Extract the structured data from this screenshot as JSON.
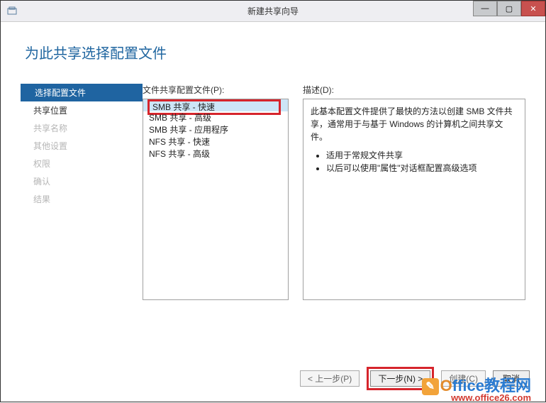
{
  "titlebar": {
    "title": "新建共享向导"
  },
  "heading": "为此共享选择配置文件",
  "sidebar": {
    "items": [
      {
        "label": "选择配置文件",
        "active": true,
        "enabled": true
      },
      {
        "label": "共享位置",
        "active": false,
        "enabled": true
      },
      {
        "label": "共享名称",
        "active": false,
        "enabled": false
      },
      {
        "label": "其他设置",
        "active": false,
        "enabled": false
      },
      {
        "label": "权限",
        "active": false,
        "enabled": false
      },
      {
        "label": "确认",
        "active": false,
        "enabled": false
      },
      {
        "label": "结果",
        "active": false,
        "enabled": false
      }
    ]
  },
  "profiles": {
    "label": "文件共享配置文件(P):",
    "items": [
      "SMB 共享 - 快速",
      "SMB 共享 - 高级",
      "SMB 共享 - 应用程序",
      "NFS 共享 - 快速",
      "NFS 共享 - 高级"
    ],
    "selected_index": 0
  },
  "description": {
    "label": "描述(D):",
    "paragraph": "此基本配置文件提供了最快的方法以创建 SMB 文件共享，通常用于与基于 Windows 的计算机之间共享文件。",
    "bullets": [
      "适用于常规文件共享",
      "以后可以使用\"属性\"对话框配置高级选项"
    ]
  },
  "footer": {
    "prev": "< 上一步(P)",
    "next": "下一步(N) >",
    "create": "创建(C)",
    "cancel": "取消"
  },
  "watermark": {
    "brand_o": "O",
    "brand_rest": "ffice教程网",
    "url": "www.office26.com"
  }
}
